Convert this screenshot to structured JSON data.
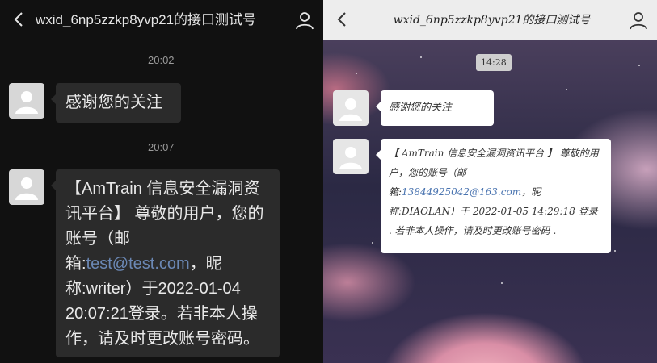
{
  "left": {
    "title": "wxid_6np5zzkp8yvp21的接口测试号",
    "timestamps": [
      "20:02",
      "20:07"
    ],
    "msg1": "感谢您的关注",
    "msg2": {
      "part1": "【AmTrain 信息安全漏洞资讯平台】 尊敬的用户，您的账号（邮箱:",
      "email": "test@test.com",
      "part2": "，昵称:writer）于2022-01-04 20:07:21登录。若非本人操作，请及时更改账号密码。"
    }
  },
  "right": {
    "title": "wxid_6np5zzkp8yvp21的接口测试号",
    "timestamp": "14:28",
    "msg1": "感谢您的关注",
    "msg2": {
      "part1": "【 AmTrain 信息安全漏洞资讯平台 】 尊敬的用户，您的账号（邮箱:",
      "email": "13844925042@163.com",
      "part2": "，昵称:DIAOLAN）于 2022-01-05 14:29:18 登录 . 若非本人操作，请及时更改账号密码 ."
    }
  },
  "icons": {
    "back": "chevron-left-icon",
    "user": "user-profile-icon",
    "avatar": "default-avatar-icon"
  },
  "colors": {
    "left_bg": "#111111",
    "left_bubble": "#2b2b2b",
    "right_header": "#ededed",
    "link_blue": "#4a74b0"
  }
}
